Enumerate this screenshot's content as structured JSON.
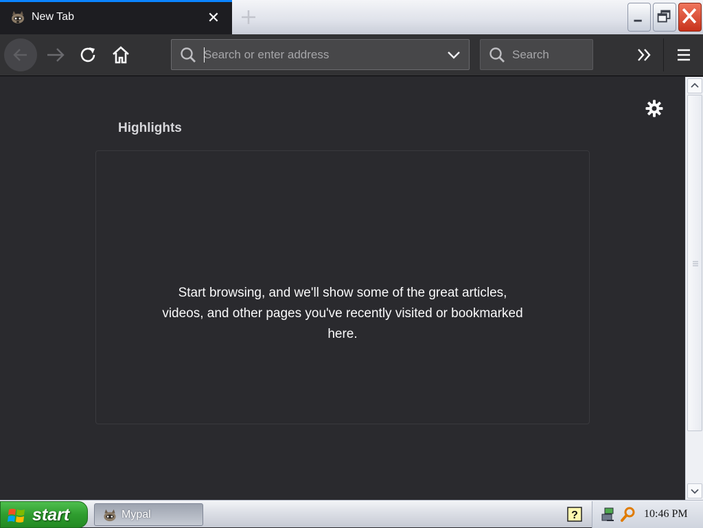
{
  "browser": {
    "tab": {
      "title": "New Tab",
      "favicon": "raccoon-icon",
      "close_icon": "close-icon",
      "close_glyph": "✕"
    },
    "new_tab_icon": "plus-icon",
    "window_controls": [
      "minimize-icon",
      "restore-icon",
      "close-icon"
    ],
    "nav": {
      "back_icon": "arrow-left-icon",
      "forward_icon": "arrow-right-icon",
      "reload_icon": "reload-icon",
      "home_icon": "home-icon"
    },
    "urlbar": {
      "placeholder": "Search or enter address",
      "value": "",
      "icon": "search-icon",
      "dropdown_icon": "chevron-down-icon"
    },
    "searchbar": {
      "placeholder": "Search",
      "value": "",
      "icon": "search-icon"
    },
    "overflow_icon": "double-chevron-right-icon",
    "menu_icon": "hamburger-menu-icon"
  },
  "newtab": {
    "settings_icon": "gear-icon",
    "highlights": {
      "title": "Highlights",
      "empty_message": "Start browsing, and we'll show some of the great articles, videos, and other pages you've recently visited or bookmarked here."
    }
  },
  "taskbar": {
    "start_label": "start",
    "items": [
      {
        "label": "Mypal",
        "icon": "raccoon-icon"
      }
    ],
    "tray_icons": [
      "help-icon",
      "network-icon",
      "search-tool-icon"
    ],
    "clock": "10:46 PM"
  },
  "colors": {
    "accent": "#0a84ff",
    "content_bg": "#2a2a2e",
    "toolbar_bg": "#323234",
    "start_green": "#2f9d2f"
  }
}
